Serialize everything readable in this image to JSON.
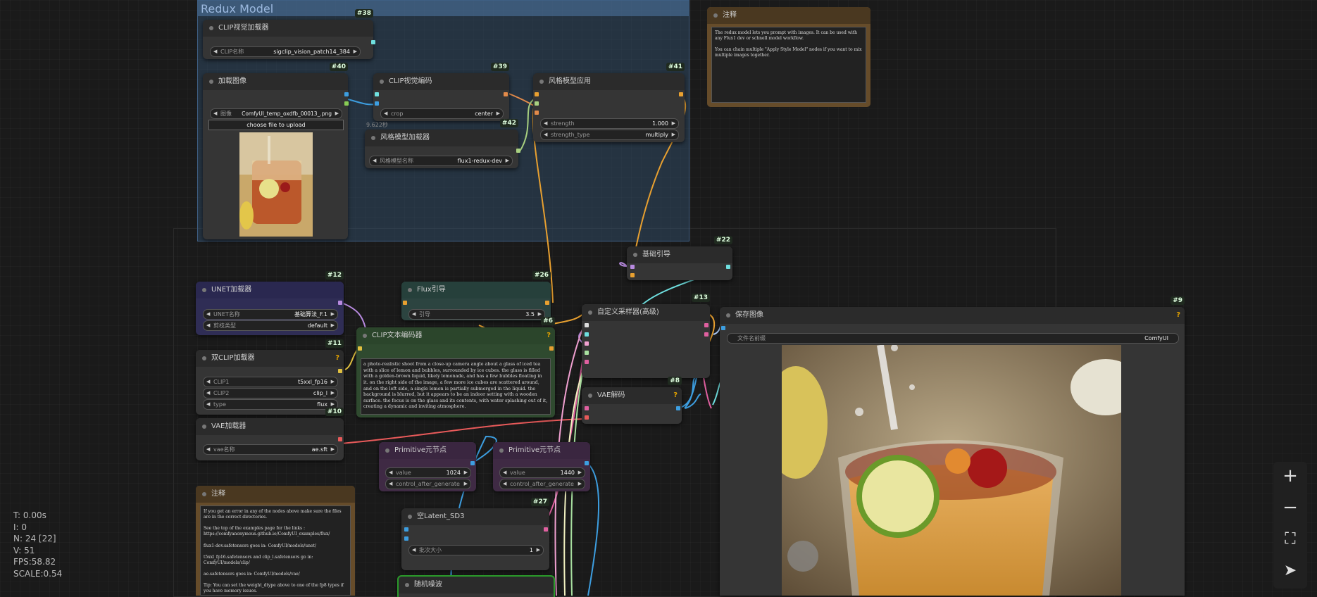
{
  "canvas": {
    "background": "#1a1a1a"
  },
  "groups": {
    "redux_title": "Redux Model"
  },
  "nodes": {
    "clip_vision_loader": {
      "id": "#38",
      "title": "CLIP视觉加载器",
      "w_label": "CLIP名称",
      "w_value": "sigclip_vision_patch14_384"
    },
    "load_image": {
      "id": "#40",
      "title": "加载图像",
      "w_label": "图像",
      "w_value": "ComfyUI_temp_oxdfb_00013_.png",
      "upload_label": "choose file to upload",
      "timer": "9.622秒"
    },
    "clip_vision_encode": {
      "id": "#39",
      "title": "CLIP视觉编码",
      "w_label": "crop",
      "w_value": "center"
    },
    "style_model_apply": {
      "id": "#41",
      "title": "风格模型应用",
      "w1_label": "strength",
      "w1_value": "1.000",
      "w2_label": "strength_type",
      "w2_value": "multiply"
    },
    "style_model_loader": {
      "id": "#42",
      "title": "风格模型加载器",
      "w_label": "风格模型名称",
      "w_value": "flux1-redux-dev"
    },
    "note_top": {
      "title": "注释",
      "text": "The redux model lets you prompt with images. It can be used with any Flux1 dev or schnell model workflow.\n\nYou can chain multiple \"Apply Style Model\" nodes if you want to mix multiple images together."
    },
    "basic_guider": {
      "id": "#22",
      "title": "基础引导"
    },
    "unet_loader": {
      "id": "#12",
      "title": "UNET加载器",
      "w1_label": "UNET名称",
      "w1_value": "基础算法_F.1",
      "w2_label": "剪枝类型",
      "w2_value": "default"
    },
    "flux_guidance": {
      "id": "#26",
      "title": "Flux引导",
      "w_label": "引导",
      "w_value": "3.5"
    },
    "clip_text_encode": {
      "id": "#6",
      "title": "CLIP文本编码器",
      "help": "?",
      "text": "a photo-realistic shoot from a close-up camera angle about a glass of iced tea with a slice of lemon and bubbles, surrounded by ice cubes. the glass is filled with a golden-brown liquid, likely lemonade, and has a few bubbles floating in it. on the right side of the image, a few more ice cubes are scattered around, and on the left side, a single lemon is partially submerged in the liquid. the background is blurred, but it appears to be an indoor setting with a wooden surface. the focus is on the glass and its contents, with water splashing out of it, creating a dynamic and inviting atmosphere."
    },
    "dual_clip_loader": {
      "id": "#11",
      "title": "双CLIP加载器",
      "help": "?",
      "w1_label": "CLIP1",
      "w1_value": "t5xxl_fp16",
      "w2_label": "CLIP2",
      "w2_value": "clip_l",
      "w3_label": "type",
      "w3_value": "flux"
    },
    "custom_sampler": {
      "id": "#13",
      "title": "自定义采样器(高级)"
    },
    "vae_decode": {
      "id": "#8",
      "title": "VAE解码",
      "help": "?"
    },
    "save_image": {
      "id": "#9",
      "title": "保存图像",
      "help": "?",
      "w_label": "文件名前缀",
      "w_value": "ComfyUI"
    },
    "vae_loader": {
      "id": "#10",
      "title": "VAE加载器",
      "w_label": "vae名称",
      "w_value": "ae.sft"
    },
    "primitive1": {
      "title": "Primitive元节点",
      "w1_label": "value",
      "w1_value": "1024",
      "w2_label": "control_after_generate",
      "w2_value": "fixed"
    },
    "primitive2": {
      "title": "Primitive元节点",
      "w1_label": "value",
      "w1_value": "1440",
      "w2_label": "control_after_generate",
      "w2_value": "fixed"
    },
    "empty_latent": {
      "id": "#27",
      "title": "空Latent_SD3",
      "w_label": "批次大小",
      "w_value": "1"
    },
    "random_noise": {
      "title": "随机噪波"
    },
    "note_bottom": {
      "title": "注释",
      "text": "If you get an error in any of the nodes above make sure the files are in the correct directories.\n\nSee the top of the examples page for the links : https://comfyanonymous.github.io/ComfyUI_examples/flux/\n\nflux1-dev.safetensors goes in: ComfyUI/models/unet/\n\nt5xxl_fp16.safetensors and clip_l.safetensors go in: ComfyUI/models/clip/\n\nae.safetensors goes in: ComfyUI/models/vae/\n\nTip: You can set the weight_dtype above to one of the fp8 types if you have memory issues."
    }
  },
  "stats": {
    "t": "T: 0.00s",
    "i": "I: 0",
    "n": "N: 24 [22]",
    "v": "V: 51",
    "fps": "FPS:58.82",
    "scale": "SCALE:0.54"
  },
  "zoom_controls": {
    "zoom_in": "+",
    "zoom_out": "−",
    "fit": "⛶",
    "locate": "➤"
  }
}
